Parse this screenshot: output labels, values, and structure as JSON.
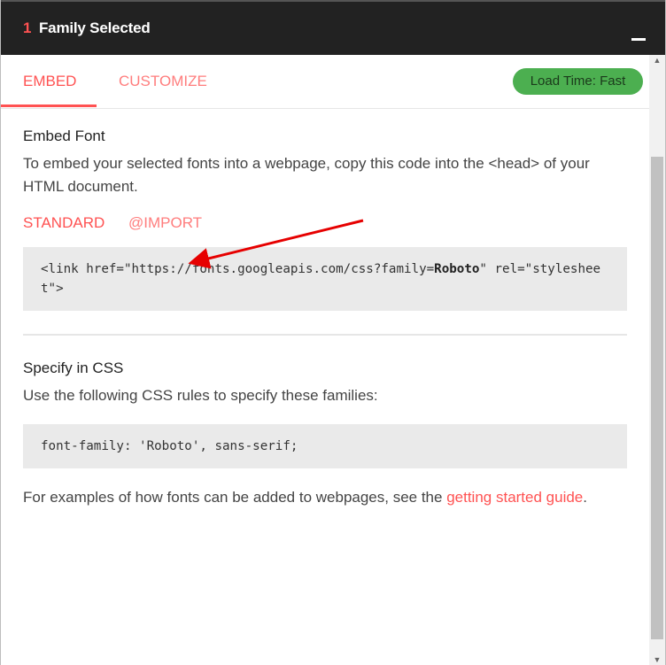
{
  "header": {
    "count": "1",
    "title": "Family Selected"
  },
  "tabs": {
    "embed": "EMBED",
    "customize": "CUSTOMIZE",
    "load_time": "Load Time: Fast"
  },
  "embed_font": {
    "heading": "Embed Font",
    "description": "To embed your selected fonts into a webpage, copy this code into the <head> of your HTML document.",
    "subtabs": {
      "standard": "STANDARD",
      "import": "@IMPORT"
    },
    "code": {
      "prefix": "<link href=\"https://fonts.googleapis.com/css?family=",
      "family": "Roboto",
      "suffix": "\" rel=\"stylesheet\">"
    }
  },
  "specify_css": {
    "heading": "Specify in CSS",
    "description": "Use the following CSS rules to specify these families:",
    "code": "font-family: 'Roboto', sans-serif;"
  },
  "footer": {
    "text_before": "For examples of how fonts can be added to webpages, see the ",
    "link": "getting started guide",
    "text_after": "."
  },
  "colors": {
    "accent": "#ff5252",
    "header_bg": "#222222",
    "badge_bg": "#4caf50",
    "annotation_arrow": "#e60000"
  },
  "icons": {
    "minimize": "minimize-icon",
    "scroll_up": "scroll-up-arrow-icon",
    "scroll_down": "scroll-down-arrow-icon",
    "annotation": "red-arrow-annotation"
  }
}
